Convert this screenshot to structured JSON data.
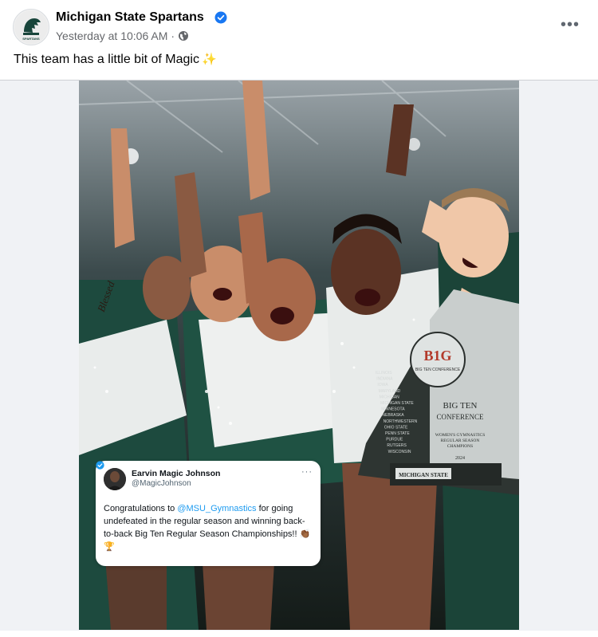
{
  "post": {
    "page_name": "Michigan State Spartans",
    "timestamp": "Yesterday at 10:06 AM",
    "separator": "·",
    "audience_icon": "globe-icon",
    "more_label": "•••",
    "text": "This team has a little bit of Magic",
    "text_emoji": "✨"
  },
  "avatar": {
    "logo_label": "SPARTANS"
  },
  "photo": {
    "trophy": {
      "logo": "B1G",
      "logo_sub": "BIG TEN CONFERENCE",
      "title_line1": "BIG TEN",
      "title_line2": "CONFERENCE",
      "caption_line1": "WOMEN'S GYMNASTICS",
      "caption_line2": "REGULAR SEASON",
      "caption_line3": "CHAMPIONS",
      "year": "2024",
      "plate": "MICHIGAN STATE",
      "schools": [
        "ILLINOIS",
        "INDIANA",
        "IOWA",
        "MARYLAND",
        "MICHIGAN",
        "MICHIGAN STATE",
        "MINNESOTA",
        "NEBRASKA",
        "NORTHWESTERN",
        "OHIO STATE",
        "PENN STATE",
        "PURDUE",
        "RUTGERS",
        "WISCONSIN"
      ]
    },
    "tattoo": "Blessed"
  },
  "tweet": {
    "name": "Earvin Magic Johnson",
    "handle": "@MagicJohnson",
    "more_label": "···",
    "body_prefix": "Congratulations to ",
    "mention": "@MSU_Gymnastics",
    "body_suffix": " for going undefeated in the regular season and winning back-to-back Big Ten Regular Season Championships!! 👏🏾🏆"
  },
  "colors": {
    "verified": "#1877f2",
    "spartan_green": "#18453b",
    "mention": "#1d9bf0"
  }
}
